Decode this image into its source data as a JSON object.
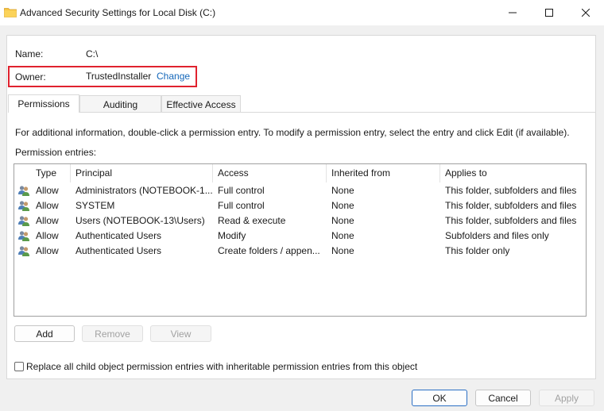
{
  "window": {
    "title": "Advanced Security Settings for Local Disk (C:)",
    "icon": "folder-icon"
  },
  "fields": {
    "name_label": "Name:",
    "name_value": "C:\\",
    "owner_label": "Owner:",
    "owner_value": "TrustedInstaller",
    "change_link": "Change"
  },
  "tabs": [
    {
      "label": "Permissions",
      "active": true
    },
    {
      "label": "Auditing",
      "active": false
    },
    {
      "label": "Effective Access",
      "active": false
    }
  ],
  "info_text": "For additional information, double-click a permission entry. To modify a permission entry, select the entry and click Edit (if available).",
  "entries_label": "Permission entries:",
  "table": {
    "columns": [
      "Type",
      "Principal",
      "Access",
      "Inherited from",
      "Applies to"
    ],
    "rows": [
      {
        "type": "Allow",
        "principal": "Administrators (NOTEBOOK-1...",
        "access": "Full control",
        "inherited": "None",
        "applies": "This folder, subfolders and files"
      },
      {
        "type": "Allow",
        "principal": "SYSTEM",
        "access": "Full control",
        "inherited": "None",
        "applies": "This folder, subfolders and files"
      },
      {
        "type": "Allow",
        "principal": "Users (NOTEBOOK-13\\Users)",
        "access": "Read & execute",
        "inherited": "None",
        "applies": "This folder, subfolders and files"
      },
      {
        "type": "Allow",
        "principal": "Authenticated Users",
        "access": "Modify",
        "inherited": "None",
        "applies": "Subfolders and files only"
      },
      {
        "type": "Allow",
        "principal": "Authenticated Users",
        "access": "Create folders / appen...",
        "inherited": "None",
        "applies": "This folder only"
      }
    ]
  },
  "entry_buttons": {
    "add": "Add",
    "remove": "Remove",
    "view": "View"
  },
  "replace_checkbox": {
    "label": "Replace all child object permission entries with inheritable permission entries from this object",
    "checked": false
  },
  "dialog_buttons": {
    "ok": "OK",
    "cancel": "Cancel",
    "apply": "Apply"
  },
  "colors": {
    "highlight_box": "#e0222e",
    "link": "#1467ba",
    "primary_border": "#2b6fc4"
  }
}
